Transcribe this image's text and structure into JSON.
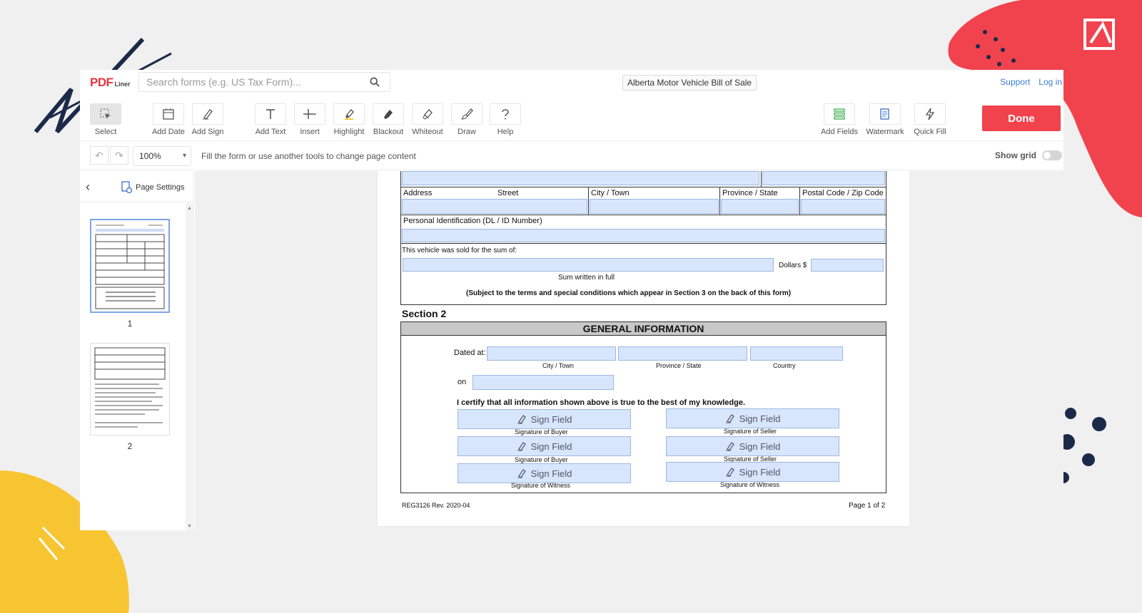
{
  "app": {
    "logo_main": "PDF",
    "logo_sub": "Liner",
    "search_placeholder": "Search forms (e.g. US Tax Form)...",
    "doc_title": "Alberta Motor Vehicle Bill of Sale",
    "support_link": "Support",
    "login_link": "Log in"
  },
  "toolbar": {
    "select": "Select",
    "add_date": "Add Date",
    "add_sign": "Add Sign",
    "add_text": "Add Text",
    "insert": "Insert",
    "highlight": "Highlight",
    "blackout": "Blackout",
    "whiteout": "Whiteout",
    "draw": "Draw",
    "help": "Help",
    "add_fields": "Add Fields",
    "watermark": "Watermark",
    "quick_fill": "Quick Fill",
    "done": "Done"
  },
  "subbar": {
    "zoom": "100%",
    "hint": "Fill the form or use another tools to change page content",
    "show_grid": "Show grid"
  },
  "sidebar": {
    "page_settings": "Page Settings",
    "pages": [
      "1",
      "2"
    ]
  },
  "form": {
    "address": "Address",
    "street": "Street",
    "city_town": "City / Town",
    "province_state": "Province / State",
    "postal_code": "Postal Code / Zip Code",
    "personal_id": "Personal Identification (DL / ID Number)",
    "sold_for": "This vehicle was sold for the sum of:",
    "dollars": "Dollars $",
    "sum_written": "Sum written in full",
    "subject_terms": "(Subject to the terms and special conditions which appear in Section 3 on the back of this form)",
    "section2": "Section 2",
    "general_info": "GENERAL INFORMATION",
    "dated_at": "Dated at:",
    "city_town_small": "City / Town",
    "province_state_small": "Province / State",
    "country": "Country",
    "on": "on",
    "certify": "I certify that all information shown above is true to the best of my knowledge.",
    "sign_field": "Sign Field",
    "sig_buyer": "Signature of Buyer",
    "sig_seller": "Signature of Seller",
    "sig_witness": "Signature of Witness",
    "form_code": "REG3126  Rev. 2020-04",
    "page_of": "Page 1 of 2"
  },
  "colors": {
    "accent": "#f1434e",
    "link": "#3a7fd5",
    "field_fill": "#d7e6fc"
  }
}
